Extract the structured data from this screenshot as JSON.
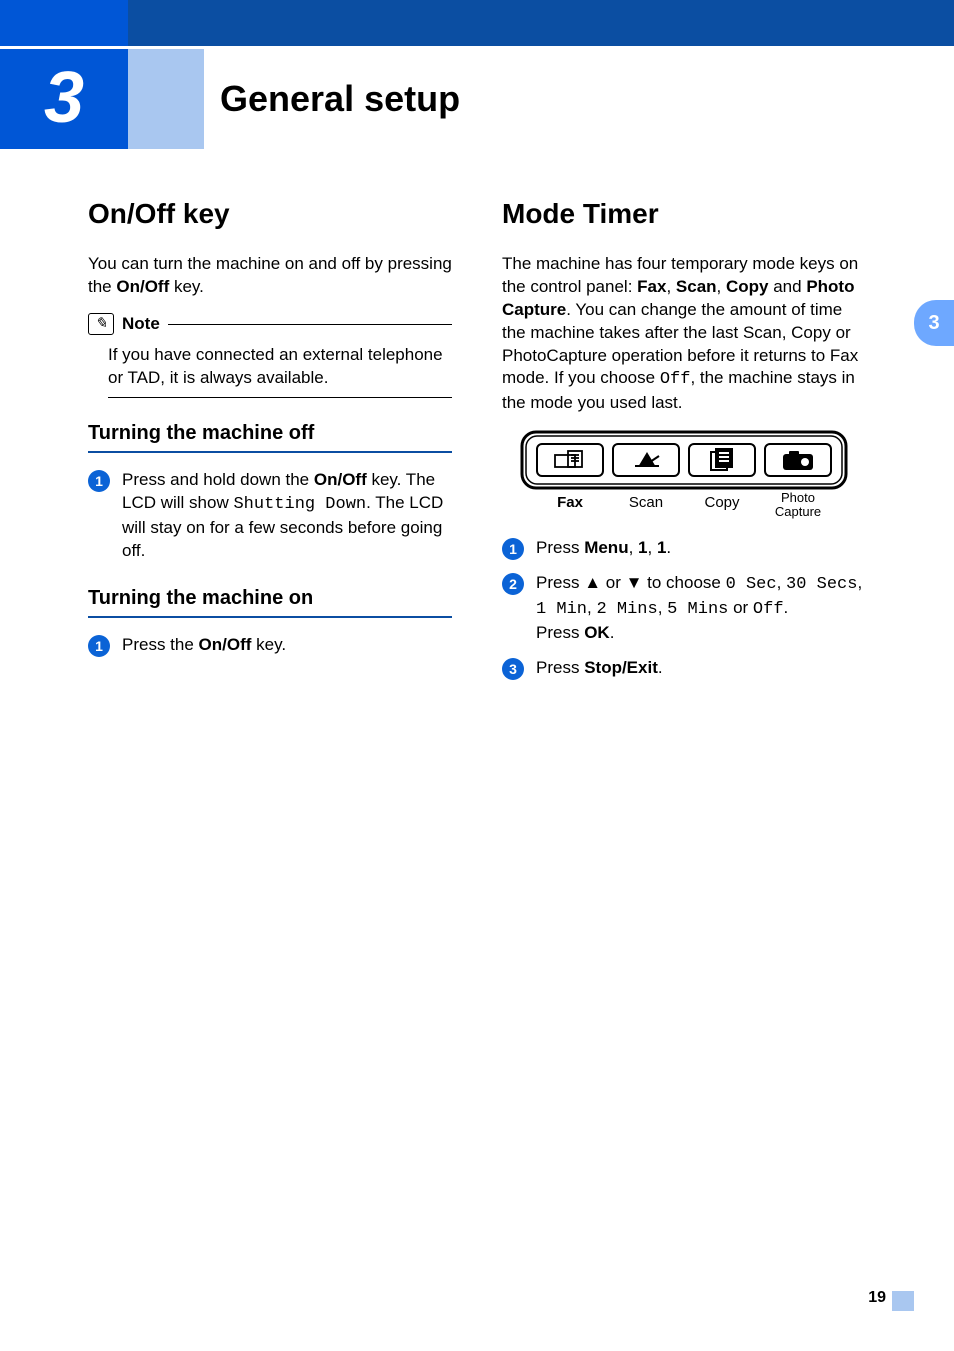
{
  "chapter": {
    "number": "3",
    "title": "General setup"
  },
  "tab": "3",
  "pageNumber": "19",
  "left": {
    "h1": "On/Off key",
    "intro_a": "You can turn the machine on and off by pressing the ",
    "intro_b_bold": "On/Off",
    "intro_c": " key.",
    "note_label": "Note",
    "note_body": "If you have connected an external telephone or TAD, it is always available.",
    "sub1": "Turning the machine off",
    "s1a": "Press and hold down the ",
    "s1b_bold": "On/Off",
    "s1c": " key. The LCD will show ",
    "s1d_mono": "Shutting Down",
    "s1e": ". The LCD will stay on for a few seconds before going off.",
    "sub2": "Turning the machine on",
    "s2a": "Press the ",
    "s2b_bold": "On/Off",
    "s2c": " key."
  },
  "right": {
    "h1": "Mode Timer",
    "p1a": "The machine has four temporary mode keys on the control panel: ",
    "p1_fax": "Fax",
    "p1s1": ", ",
    "p1_scan": "Scan",
    "p1s2": ", ",
    "p1_copy": "Copy",
    "p1s3": " and ",
    "p1_pc": "Photo Capture",
    "p1b": ". You can change the amount of time the machine takes after the last Scan, Copy or PhotoCapture operation before it returns to Fax mode. If you choose ",
    "p1_off": "Off",
    "p1c": ", the machine stays in the mode you used last.",
    "panel": {
      "fax": "Fax",
      "scan": "Scan",
      "copy": "Copy",
      "pc1": "Photo",
      "pc2": "Capture"
    },
    "step1a": "Press ",
    "step1_menu": "Menu",
    "step1b": ", ",
    "step1_n1": "1",
    "step1c": ", ",
    "step1_n2": "1",
    "step1d": ".",
    "step2a": "Press ",
    "step2_up": "▲",
    "step2b": " or ",
    "step2_dn": "▼",
    "step2c": " to choose ",
    "opt0": "0 Sec",
    "c1": ", ",
    "opt1": "30 Secs",
    "c2": ", ",
    "opt2": "1 Min",
    "c3": ", ",
    "opt3": "2 Mins",
    "c4": ", ",
    "opt4": "5 Mins",
    "c5": " or ",
    "opt5": "Off",
    "c6": ".",
    "step2d": "Press ",
    "step2_ok": "OK",
    "step2e": ".",
    "step3a": "Press ",
    "step3_se": "Stop/Exit",
    "step3b": "."
  }
}
